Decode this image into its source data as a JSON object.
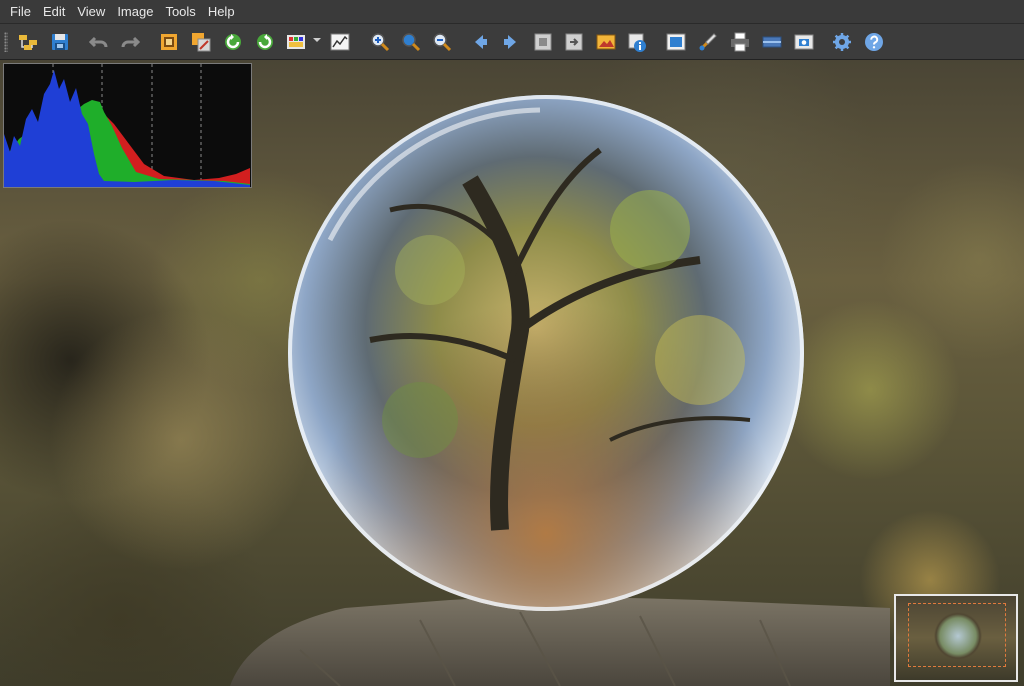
{
  "menubar": {
    "items": [
      "File",
      "Edit",
      "View",
      "Image",
      "Tools",
      "Help"
    ]
  },
  "toolbar": {
    "buttons": [
      "open-folder-icon",
      "save-icon",
      "undo-icon",
      "redo-icon",
      "crop-icon",
      "resize-icon",
      "rotate-left-icon",
      "rotate-right-icon",
      "color-adjust-icon",
      "histogram-icon",
      "zoom-in-icon",
      "zoom-fit-icon",
      "zoom-out-icon",
      "previous-icon",
      "next-icon",
      "copy-to-icon",
      "move-to-icon",
      "slideshow-icon",
      "image-info-icon",
      "fullscreen-icon",
      "paint-icon",
      "print-icon",
      "scanner-icon",
      "screenshot-icon",
      "settings-icon",
      "help-icon"
    ]
  },
  "colors": {
    "histogram_blue": "#1f3fd6",
    "histogram_green": "#1fae2a",
    "histogram_red": "#d21f1f",
    "navigator_frame": "#e07a3c"
  }
}
